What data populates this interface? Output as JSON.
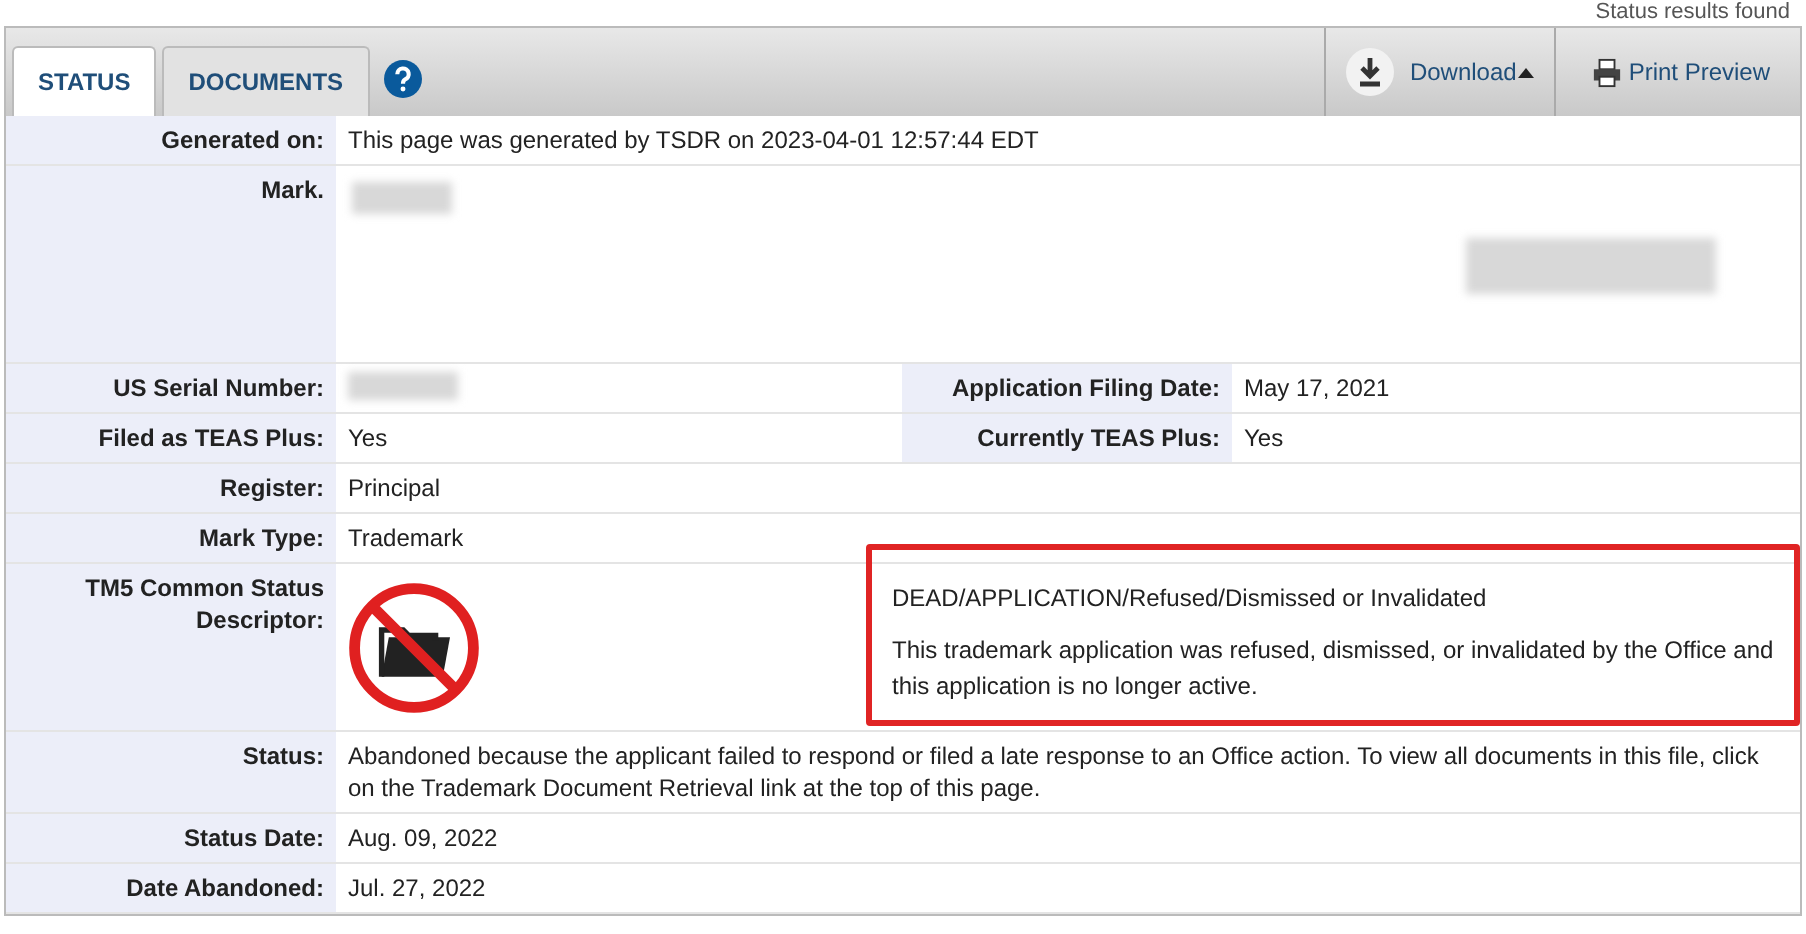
{
  "header_note": "Status results found",
  "tabs": [
    {
      "label": "STATUS",
      "selected": true
    },
    {
      "label": "DOCUMENTS",
      "selected": false
    }
  ],
  "toolbar": {
    "download": "Download",
    "print": "Print Preview"
  },
  "rows": [
    {
      "kind": "text",
      "label": "Generated on:",
      "value": "This page was generated by TSDR on 2023-04-01 12:57:44 EDT"
    },
    {
      "kind": "mark",
      "label": "Mark."
    },
    {
      "kind": "pair",
      "label": "US Serial Number:",
      "value": "",
      "label_2": "Application Filing Date:",
      "value_2": "May 17, 2021"
    },
    {
      "kind": "pair",
      "label": "Filed as TEAS Plus:",
      "value": "Yes",
      "label_2": "Currently TEAS Plus:",
      "value_2": "Yes"
    },
    {
      "kind": "text",
      "label": "Register:",
      "value": "Principal"
    },
    {
      "kind": "text",
      "label": "Mark Type:",
      "value": "Trademark"
    },
    {
      "kind": "descriptor",
      "label": "TM5 Common Status Descriptor:",
      "title": "DEAD/APPLICATION/Refused/Dismissed or Invalidated",
      "description": "This trademark application was refused, dismissed, or invalidated by the Office and this application is no longer active.",
      "highlighted": true
    },
    {
      "kind": "text",
      "label": "Status:",
      "value": "Abandoned because the applicant failed to respond or filed a late response to an Office action. To view all documents in this file, click on the Trademark Document Retrieval link at the top of this page."
    },
    {
      "kind": "text",
      "label": "Status Date:",
      "value": "Aug. 09, 2022"
    },
    {
      "kind": "text",
      "label": "Date Abandoned:",
      "value": "Jul. 27, 2022"
    }
  ]
}
